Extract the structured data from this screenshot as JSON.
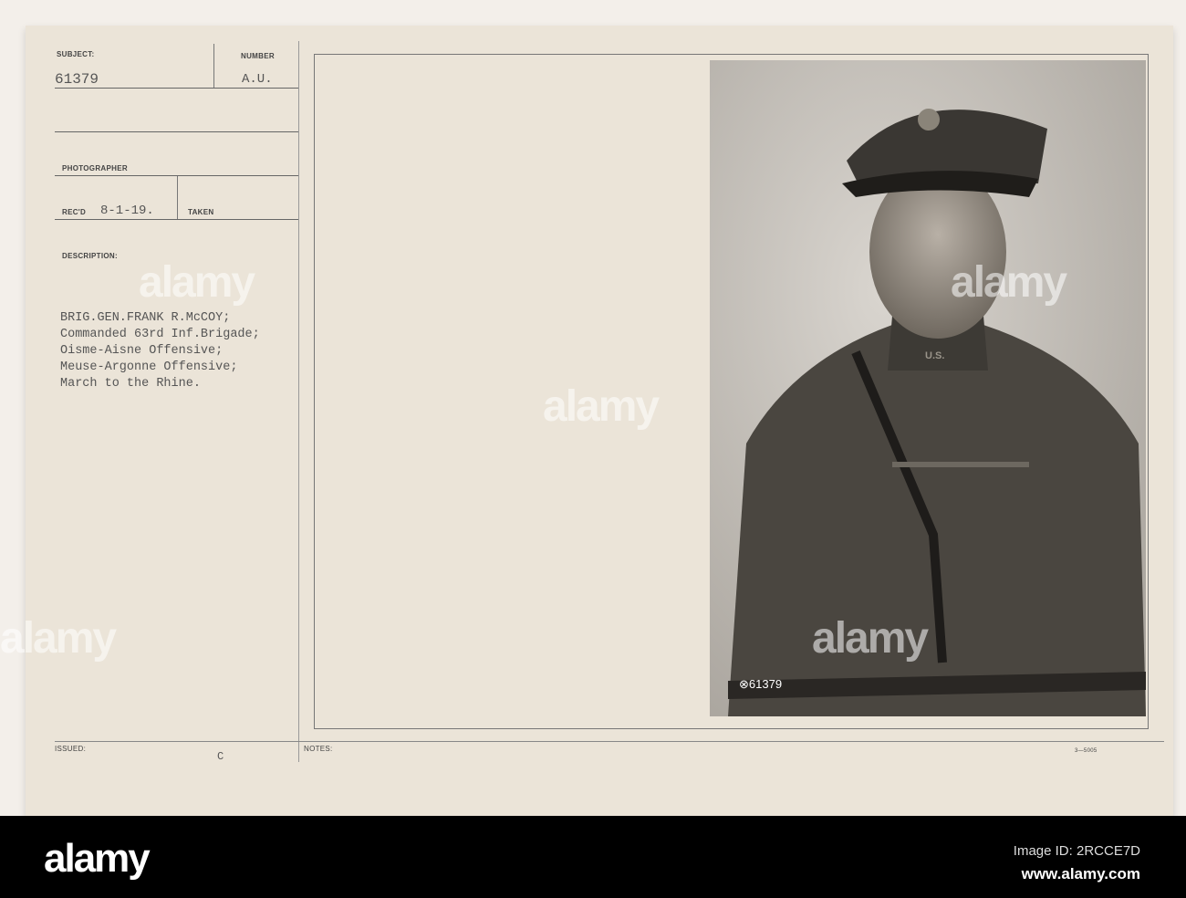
{
  "card": {
    "subject_label": "SUBJECT:",
    "subject_value": "61379",
    "number_label": "NUMBER",
    "number_value": "A.U.",
    "photographer_label": "PHOTOGRAPHER",
    "recd_label": "REC'D",
    "recd_value": "8-1-19.",
    "taken_label": "TAKEN",
    "description_label": "DESCRIPTION:",
    "description_lines": [
      "BRIG.GEN.FRANK R.McCOY;",
      "Commanded 63rd Inf.Brigade;",
      "Oisme-Aisne Offensive;",
      "Meuse-Argonne Offensive;",
      "March to the Rhine."
    ],
    "issued_label": "ISSUED:",
    "issued_value": "C",
    "notes_label": "NOTES:",
    "form_number": "3—5005"
  },
  "photo": {
    "negative_number": "⊗61379",
    "cap_badge": "U.S."
  },
  "watermark": {
    "text": "alamy",
    "image_id": "Image ID: 2RCCE7D",
    "url": "www.alamy.com"
  }
}
